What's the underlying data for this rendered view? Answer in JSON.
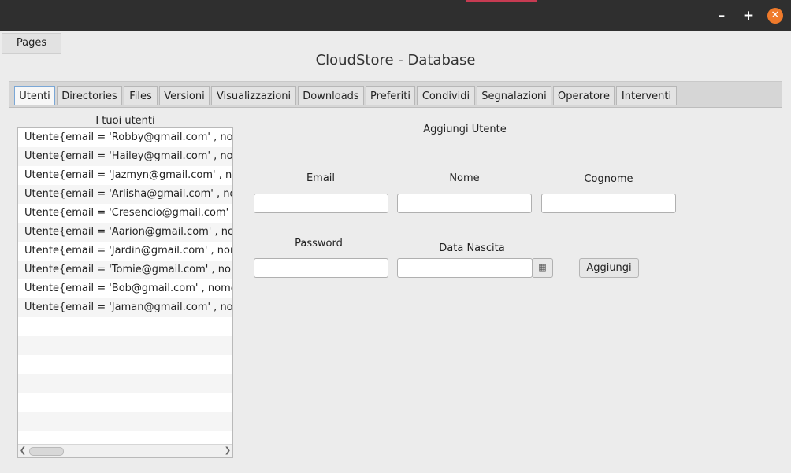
{
  "window": {
    "minimize": "–",
    "maximize": "+",
    "close": "✕"
  },
  "menu": {
    "pages": "Pages"
  },
  "app_title": "CloudStore - Database",
  "tabs": [
    {
      "label": "Utenti",
      "active": true
    },
    {
      "label": "Directories"
    },
    {
      "label": "Files"
    },
    {
      "label": "Versioni"
    },
    {
      "label": "Visualizzazioni"
    },
    {
      "label": "Downloads"
    },
    {
      "label": "Preferiti"
    },
    {
      "label": "Condividi"
    },
    {
      "label": "Segnalazioni"
    },
    {
      "label": "Operatore"
    },
    {
      "label": "Interventi"
    }
  ],
  "users_list": {
    "label": "I tuoi utenti",
    "items": [
      "Utente{email = 'Robby@gmail.com' , no",
      "Utente{email = 'Hailey@gmail.com' , no",
      "Utente{email = 'Jazmyn@gmail.com' , no",
      "Utente{email = 'Arlisha@gmail.com' , no",
      "Utente{email = 'Cresencio@gmail.com'",
      "Utente{email = 'Aarion@gmail.com' , no",
      "Utente{email = 'Jardin@gmail.com' , nor",
      "Utente{email = 'Tomie@gmail.com' , no",
      "Utente{email = 'Bob@gmail.com' , nome",
      "Utente{email = 'Jaman@gmail.com' , no"
    ]
  },
  "form": {
    "title": "Aggiungi Utente",
    "email_label": "Email",
    "email_value": "",
    "nome_label": "Nome",
    "nome_value": "",
    "cognome_label": "Cognome",
    "cognome_value": "",
    "password_label": "Password",
    "password_value": "",
    "data_label": "Data Nascita",
    "data_value": "",
    "calendar_icon": "▦",
    "submit": "Aggiungi"
  },
  "colors": {
    "titlebar": "#2f2f2f",
    "close_button": "#ef7a2b",
    "active_tab_border": "#7aa7d6"
  }
}
